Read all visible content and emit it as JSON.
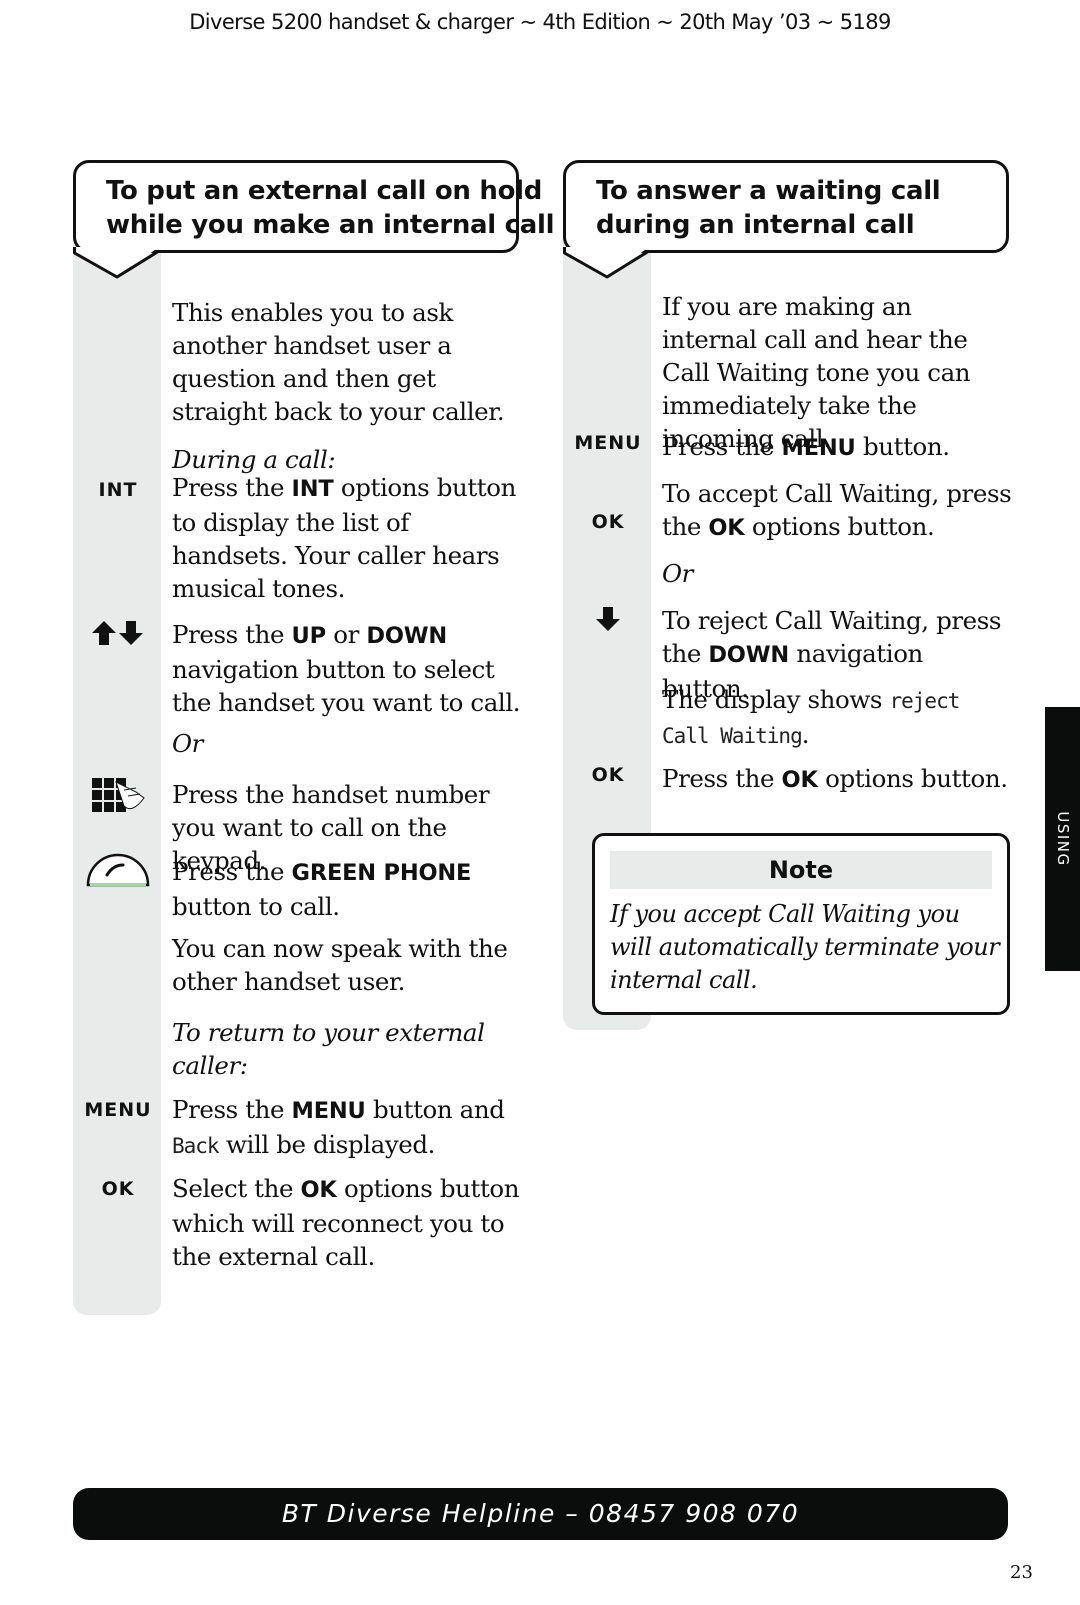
{
  "header": {
    "running_head": "Diverse 5200 handset & charger ~ 4th Edition ~ 20th May ’03 ~ 5189"
  },
  "left_section": {
    "title_lines": [
      "To put an external call on hold",
      "while you make an internal call"
    ],
    "intro": "This enables you to ask another handset user a question and then get straight back to your caller.",
    "steps": [
      {
        "icon": "",
        "icon_name": "",
        "segments": [
          {
            "t": "During a call:",
            "s": "i"
          }
        ]
      },
      {
        "icon": "INT",
        "icon_name": "int-button-icon",
        "segments": [
          {
            "t": "Press the "
          },
          {
            "t": "INT",
            "s": "b"
          },
          {
            "t": " options button to display the list of handsets. Your caller hears musical tones."
          }
        ]
      },
      {
        "icon": "",
        "icon_name": "up-down-arrows-icon",
        "segments": [
          {
            "t": "Press the "
          },
          {
            "t": "UP",
            "s": "b"
          },
          {
            "t": " or "
          },
          {
            "t": "DOWN",
            "s": "b"
          },
          {
            "t": " navigation button to select the handset you want to call."
          }
        ]
      },
      {
        "icon": "",
        "icon_name": "",
        "segments": [
          {
            "t": "Or",
            "s": "i"
          }
        ]
      },
      {
        "icon": "",
        "icon_name": "keypad-icon",
        "segments": [
          {
            "t": "Press the handset number you want to call on the keypad."
          }
        ]
      },
      {
        "icon": "",
        "icon_name": "green-phone-icon",
        "segments": [
          {
            "t": "Press the "
          },
          {
            "t": "GREEN PHONE",
            "s": "b"
          },
          {
            "t": " button to call."
          }
        ]
      },
      {
        "icon": "",
        "icon_name": "",
        "segments": [
          {
            "t": "You can now speak with the other handset user."
          }
        ]
      },
      {
        "icon": "",
        "icon_name": "",
        "segments": [
          {
            "t": "To return to your external caller:",
            "s": "i"
          }
        ]
      },
      {
        "icon": "MENU",
        "icon_name": "menu-button-icon",
        "segments": [
          {
            "t": "Press the "
          },
          {
            "t": "MENU",
            "s": "b"
          },
          {
            "t": " button and "
          },
          {
            "t": "Back",
            "s": "lcd"
          },
          {
            "t": " will be displayed."
          }
        ]
      },
      {
        "icon": "OK",
        "icon_name": "ok-button-icon",
        "segments": [
          {
            "t": "Select the "
          },
          {
            "t": "OK",
            "s": "b"
          },
          {
            "t": " options button which will reconnect you to the external call."
          }
        ]
      }
    ]
  },
  "right_section": {
    "title_lines": [
      "To answer a waiting call",
      "during an internal call"
    ],
    "intro": "If you are making an internal call and hear the Call Waiting tone you can immediately take the incoming call.",
    "steps": [
      {
        "icon": "MENU",
        "icon_name": "menu-button-icon",
        "segments": [
          {
            "t": "Press the "
          },
          {
            "t": "MENU",
            "s": "b"
          },
          {
            "t": " button."
          }
        ]
      },
      {
        "icon": "OK",
        "icon_name": "ok-button-icon",
        "segments": [
          {
            "t": "To accept Call Waiting, press the "
          },
          {
            "t": "OK",
            "s": "b"
          },
          {
            "t": " options button."
          }
        ]
      },
      {
        "icon": "",
        "icon_name": "",
        "segments": [
          {
            "t": "Or",
            "s": "i"
          }
        ]
      },
      {
        "icon": "",
        "icon_name": "down-arrow-icon",
        "segments": [
          {
            "t": "To reject Call Waiting, press the "
          },
          {
            "t": "DOWN",
            "s": "b"
          },
          {
            "t": " navigation button."
          }
        ]
      },
      {
        "icon": "",
        "icon_name": "",
        "segments": [
          {
            "t": "The display shows "
          },
          {
            "t": "reject Call Waiting",
            "s": "lcd"
          },
          {
            "t": "."
          }
        ]
      },
      {
        "icon": "OK",
        "icon_name": "ok-button-icon",
        "segments": [
          {
            "t": "Press the "
          },
          {
            "t": "OK",
            "s": "b"
          },
          {
            "t": " options button."
          }
        ]
      }
    ],
    "note": {
      "title": "Note",
      "body": "If you accept Call Waiting you will automatically terminate your internal call."
    }
  },
  "side_tab": {
    "label": "USING"
  },
  "footer": {
    "helpline": "BT Diverse Helpline – 08457 908 070",
    "page_number": "23"
  }
}
